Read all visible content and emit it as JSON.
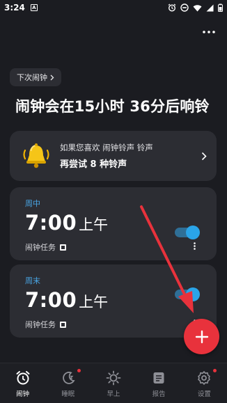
{
  "status_bar": {
    "time": "3:24",
    "app_icon_letter": "A"
  },
  "header": {
    "next_alarm_chip": "下次闹钟",
    "headline": "闹钟会在15小时 36分后响铃"
  },
  "promo": {
    "line1": "如果您喜欢 闹钟铃声 铃声",
    "line2": "再尝试 8 种铃声"
  },
  "alarms": [
    {
      "days": "周中",
      "time": "7:00",
      "ampm": "上午",
      "mission": "闹钟任务",
      "enabled": true
    },
    {
      "days": "周末",
      "time": "7:00",
      "ampm": "上午",
      "mission": "闹钟任务",
      "enabled": true
    }
  ],
  "bottom_nav": [
    {
      "label": "闹钟",
      "icon": "alarm-clock-icon",
      "active": true
    },
    {
      "label": "睡眠",
      "icon": "moon-icon",
      "active": false,
      "badge": true
    },
    {
      "label": "早上",
      "icon": "sun-icon",
      "active": false
    },
    {
      "label": "报告",
      "icon": "report-icon",
      "active": false
    },
    {
      "label": "设置",
      "icon": "gear-icon",
      "active": false,
      "badge": true
    }
  ],
  "colors": {
    "background": "#1b1c21",
    "card": "#2c2d33",
    "accent": "#2aa4e8",
    "fab": "#e8323c",
    "arrow": "#e8323c"
  }
}
